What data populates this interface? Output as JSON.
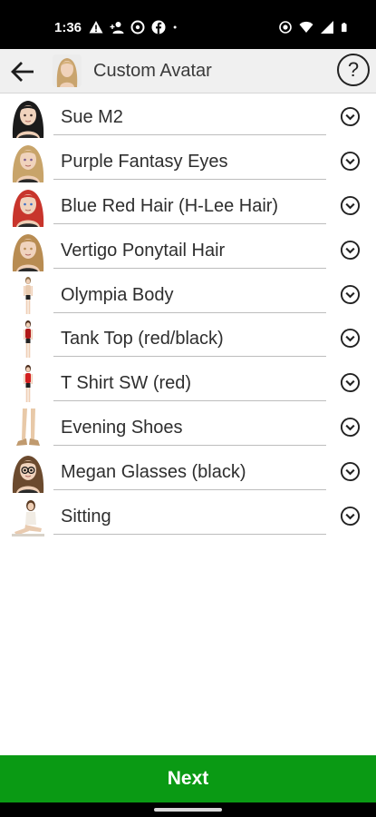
{
  "status_bar": {
    "time": "1:36",
    "left_icons": [
      "warning-icon",
      "person-add-icon",
      "vpn-icon",
      "facebook-icon",
      "dot-icon"
    ],
    "right_icons": [
      "location-icon",
      "wifi-icon",
      "signal-icon",
      "battery-icon"
    ]
  },
  "app_bar": {
    "back_icon": "arrow-back-icon",
    "title": "Custom Avatar",
    "help_label": "?"
  },
  "items": [
    {
      "label": "Sue M2",
      "thumb": "head",
      "hair": "#1b1b1b",
      "accent": "#3a2b28"
    },
    {
      "label": "Purple Fantasy Eyes",
      "thumb": "head",
      "hair": "#c8a46a",
      "accent": "#7a5a8f"
    },
    {
      "label": "Blue Red Hair (H-Lee Hair)",
      "thumb": "head",
      "hair": "#c8352c",
      "accent": "#3a6fc9"
    },
    {
      "label": "Vertigo Ponytail Hair",
      "thumb": "head",
      "hair": "#b88c52",
      "accent": "#b88c52"
    },
    {
      "label": "Olympia Body",
      "thumb": "body",
      "hair": "#8a6a44",
      "accent": "#e9cbb0"
    },
    {
      "label": "Tank Top (red/black)",
      "thumb": "body",
      "hair": "#4a2a1a",
      "accent": "#b01818"
    },
    {
      "label": "T Shirt SW (red)",
      "thumb": "body",
      "hair": "#4a2a1a",
      "accent": "#d21f1f"
    },
    {
      "label": "Evening Shoes",
      "thumb": "legs",
      "hair": "#c09a6e",
      "accent": "#e8c9a8"
    },
    {
      "label": "Megan Glasses (black)",
      "thumb": "head",
      "hair": "#6b4a2e",
      "accent": "#111111"
    },
    {
      "label": "Sitting",
      "thumb": "sitting",
      "hair": "#5a3a22",
      "accent": "#f1ece4"
    }
  ],
  "row_action_icon": "chevron-down-circle-icon",
  "next_button": {
    "label": "Next"
  },
  "colors": {
    "next_button_bg": "#0a9a14",
    "app_bar_bg": "#f0f0f0"
  }
}
